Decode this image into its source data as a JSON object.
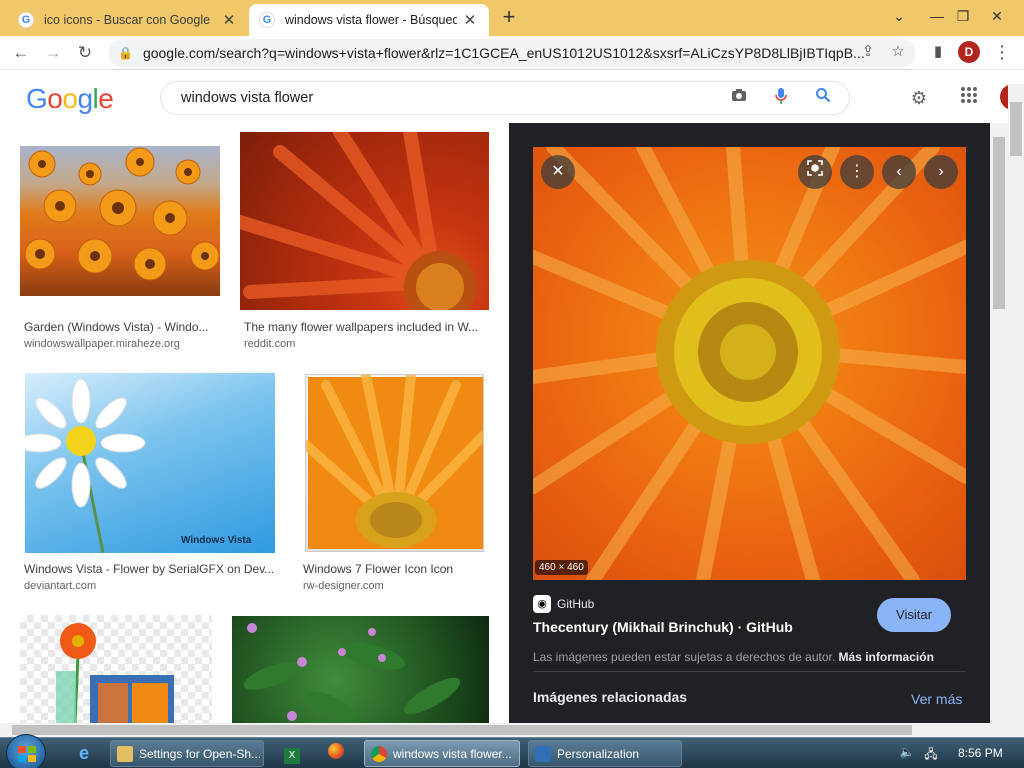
{
  "browser": {
    "tabs": [
      {
        "label": "ico icons - Buscar con Google",
        "active": false
      },
      {
        "label": "windows vista flower - Búsqueda",
        "active": true
      }
    ],
    "address": "google.com/search?q=windows+vista+flower&rlz=1C1GCEA_enUS1012US1012&sxsrf=ALiCzsYP8D8LlBjIBTIqpB...",
    "profile_initial": "D"
  },
  "google": {
    "logo_letters": [
      "G",
      "o",
      "o",
      "g",
      "l",
      "e"
    ],
    "logo_colors": [
      "#4285f4",
      "#ea4335",
      "#fbbc05",
      "#4285f4",
      "#34a853",
      "#ea4335"
    ],
    "query": "windows vista flower"
  },
  "results": [
    {
      "title": "Garden (Windows Vista) - Windo...",
      "source": "windowswallpaper.miraheze.org"
    },
    {
      "title": "The many flower wallpapers included in W...",
      "source": "reddit.com"
    },
    {
      "title": "Windows Vista - Flower by SerialGFX on Dev...",
      "source": "deviantart.com"
    },
    {
      "title": "Windows 7 Flower Icon Icon",
      "source": "rw-designer.com"
    },
    {
      "watermark": "Windows Vista"
    }
  ],
  "preview": {
    "dimensions": "460 × 460",
    "source": "GitHub",
    "title": "Thecentury (Mikhail Brinchuk) · GitHub",
    "visit_label": "Visitar",
    "copyright": "Las imágenes pueden estar sujetas a derechos de autor.",
    "copyright_link": "Más información",
    "related_label": "Imágenes relacionadas",
    "see_more_label": "Ver más"
  },
  "taskbar": {
    "buttons": [
      {
        "label": "Settings for Open-Sh..."
      },
      {
        "label": "windows vista flower..."
      },
      {
        "label": "Personalization"
      }
    ],
    "clock": "8:56 PM"
  },
  "icons": {
    "close": "close-icon",
    "lens": "lens-icon",
    "more": "more-vert-icon",
    "prev": "chevron-left-icon",
    "next": "chevron-right-icon"
  }
}
